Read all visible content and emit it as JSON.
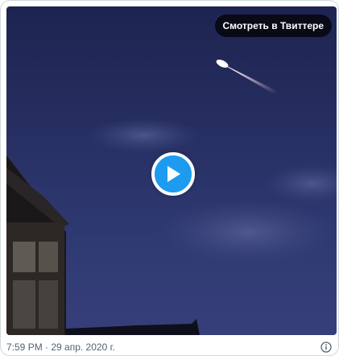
{
  "tweet": {
    "watch_label": "Смотреть в Твиттере",
    "timestamp": "7:59 PM · 29 апр. 2020 г."
  },
  "icons": {
    "play": "play-icon",
    "info": "info-icon"
  },
  "colors": {
    "accent": "#1d9bf0",
    "sky": "#2a3366",
    "text_secondary": "#536471"
  }
}
